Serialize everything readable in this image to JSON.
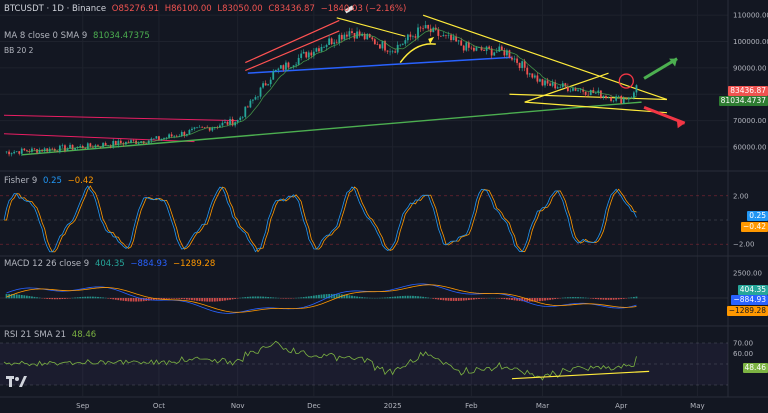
{
  "header": {
    "symbol": "BTCUSDT · 1D · Binance",
    "open": "O85276.91",
    "high": "H86100.00",
    "low": "L83050.00",
    "close": "C83436.87",
    "change": "−1840.03 (−2.16%)",
    "ma_label": "MA 8 close 0 SMA 9",
    "ma_value": "81034.47375",
    "bb_label": "BB 20 2"
  },
  "price_tags": {
    "close": "83436.87",
    "ma": "81034.4737"
  },
  "fisher": {
    "label": "Fisher 9",
    "v1": "0.25",
    "v2": "−0.42",
    "tag1": "0.25",
    "tag2": "−0.42"
  },
  "macd": {
    "label": "MACD 12 26 close 9",
    "v1": "404.35",
    "v2": "−884.93",
    "v3": "−1289.28",
    "tag1": "404.35",
    "tag2": "−884.93",
    "tag3": "−1289.28"
  },
  "rsi": {
    "label": "RSI 21 SMA 21",
    "v1": "48.46",
    "tag1": "48.46"
  },
  "colors": {
    "bg": "#131722",
    "up": "#26a69a",
    "down": "#ef5350",
    "yellow": "#ffeb3b",
    "blue": "#2962ff",
    "green": "#4caf50",
    "red": "#f23645",
    "fisher": "#2196f3",
    "trigger": "#ff9800",
    "rsi": "#7cb342"
  },
  "chart_data": [
    {
      "type": "candlestick",
      "title": "BTCUSDT · 1D · Binance",
      "y_ticks": [
        60000,
        70000,
        80000,
        90000,
        100000,
        110000
      ],
      "y_tick_labels": [
        "60000.00",
        "70000.00",
        "80000.00",
        "90000.00",
        "100000.00",
        "110000.00"
      ],
      "x_tick_labels": [
        "Sep",
        "Oct",
        "Nov",
        "Dec",
        "2025",
        "Feb",
        "Mar",
        "Apr",
        "May"
      ],
      "ylim": [
        52000,
        115000
      ],
      "close_path": [
        [
          "Aug",
          58000
        ],
        [
          "Sep",
          60000
        ],
        [
          "Oct",
          63000
        ],
        [
          "Nov",
          70000
        ],
        [
          "Nov",
          88000
        ],
        [
          "Dec",
          97000
        ],
        [
          "Dec",
          104000
        ],
        [
          "2025",
          97000
        ],
        [
          "Jan",
          105000
        ],
        [
          "Feb",
          97000
        ],
        [
          "Feb",
          96000
        ],
        [
          "Mar",
          84000
        ],
        [
          "Mar",
          82000
        ],
        [
          "Apr",
          78000
        ],
        [
          "Apr",
          83436.87
        ]
      ],
      "annotations": [
        "MA 8 close 0 SMA 9: 81034.47375"
      ]
    },
    {
      "type": "line",
      "title": "Fisher 9",
      "y_tick_labels": [
        "2.00",
        "0.00",
        "−2.00"
      ],
      "series": [
        {
          "name": "Fisher",
          "last": 0.25
        },
        {
          "name": "Trigger",
          "last": -0.42
        }
      ]
    },
    {
      "type": "bar",
      "title": "MACD 12 26 close 9",
      "y_tick_labels": [
        "2500.00",
        "0.00"
      ],
      "series": [
        {
          "name": "Histogram",
          "last": 404.35
        },
        {
          "name": "MACD",
          "last": -884.93
        },
        {
          "name": "Signal",
          "last": -1289.28
        }
      ]
    },
    {
      "type": "line",
      "title": "RSI 21 SMA 21",
      "y_tick_labels": [
        "70.00",
        "60.00",
        "40.00"
      ],
      "series": [
        {
          "name": "RSI",
          "last": 48.46
        }
      ]
    }
  ]
}
